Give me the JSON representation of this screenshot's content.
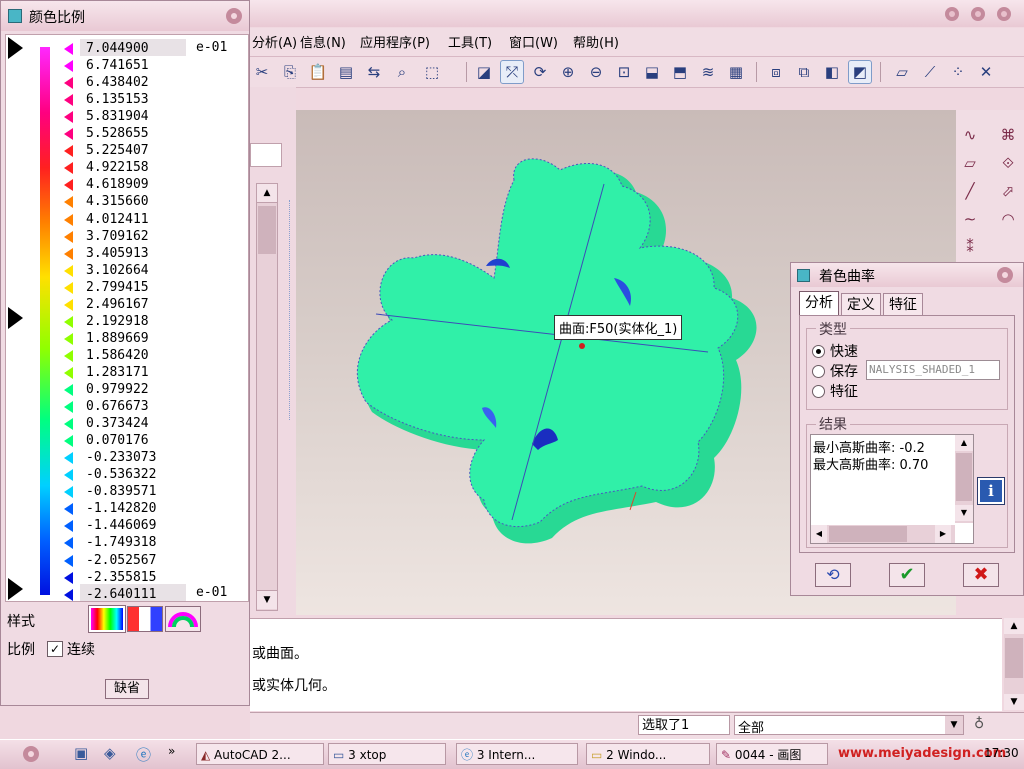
{
  "color_scale_panel": {
    "title": "颜色比例",
    "exponent_top": "e-01",
    "exponent_bottom": "e-01",
    "values": [
      "7.044900",
      "6.741651",
      "6.438402",
      "6.135153",
      "5.831904",
      "5.528655",
      "5.225407",
      "4.922158",
      "4.618909",
      "4.315660",
      "4.012411",
      "3.709162",
      "3.405913",
      "3.102664",
      "2.799415",
      "2.496167",
      "2.192918",
      "1.889669",
      "1.586420",
      "1.283171",
      "0.979922",
      "0.676673",
      "0.373424",
      "0.070176",
      "-0.233073",
      "-0.536322",
      "-0.839571",
      "-1.142820",
      "-1.446069",
      "-1.749318",
      "-2.052567",
      "-2.355815",
      "-2.640111"
    ],
    "style_label": "样式",
    "scale_label": "比例",
    "continuous_label": "连续",
    "continuous_checked": true,
    "default_button": "缺省"
  },
  "menu": [
    "分析(A)",
    "信息(N)",
    "应用程序(P)",
    "工具(T)",
    "窗口(W)",
    "帮助(H)"
  ],
  "tooltip": "曲面:F50(实体化_1)",
  "messages": [
    "或曲面。",
    "或实体几何。"
  ],
  "status": {
    "selection_count": "选取了1",
    "filter_value": "全部"
  },
  "analysis_dialog": {
    "title": "着色曲率",
    "tabs": [
      "分析",
      "定义",
      "特征"
    ],
    "active_tab": "分析",
    "type_group": "类型",
    "options": [
      "快速",
      "保存",
      "特征"
    ],
    "selected_option": "快速",
    "save_name": "NALYSIS_SHADED_1",
    "result_group": "结果",
    "results": [
      "最小高斯曲率: -0.2",
      "最大高斯曲率: 0.70"
    ]
  },
  "taskbar": {
    "tasks": [
      "AutoCAD 2...",
      "3 xtop",
      "3 Intern...",
      "2 Windo...",
      "0044 - 画图"
    ],
    "watermark": "www.meiyadesign.com",
    "clock": "17:30"
  },
  "colors": {
    "surface": "#2ef0a8",
    "accent": "#6c1f3f"
  }
}
